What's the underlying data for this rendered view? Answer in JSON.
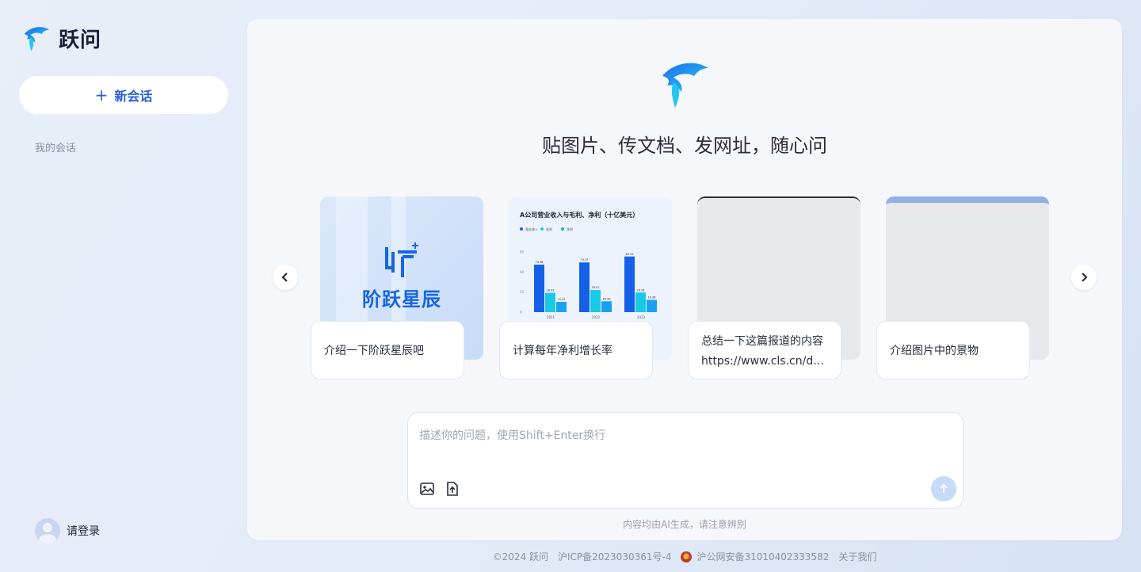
{
  "app": {
    "name": "跃问"
  },
  "sidebar": {
    "new_chat_label": "新会话",
    "section_title": "我的会话",
    "login_label": "请登录"
  },
  "main": {
    "headline": "贴图片、传文档、发网址，随心问",
    "cards": [
      {
        "prompt": "介绍一下阶跃星辰吧",
        "sub": "",
        "brand": "阶跃星辰"
      },
      {
        "prompt": "计算每年净利增长率",
        "sub": ""
      },
      {
        "prompt": "总结一下这篇报道的内容",
        "sub": "https://www.cls.cn/det..."
      },
      {
        "prompt": "介绍图片中的景物",
        "sub": ""
      }
    ],
    "input": {
      "placeholder": "描述你的问题，使用Shift+Enter换行"
    },
    "disclaimer": "内容均由AI生成，请注意辨别"
  },
  "chart_data": {
    "type": "bar",
    "title": "A公司营业收入与毛利、净利（十亿美元）",
    "categories": [
      "2021",
      "2022",
      "2023"
    ],
    "series": [
      {
        "name": "营业收入",
        "values": [
          70.98,
          74.33,
          83.19
        ]
      },
      {
        "name": "毛利",
        "values": [
          28.92,
          33.01,
          29.28
        ]
      },
      {
        "name": "净利",
        "values": [
          15.32,
          16.28,
          18.36
        ]
      }
    ],
    "ylim": [
      0,
      90
    ],
    "yticks": [
      "90",
      "60",
      "30",
      "0"
    ],
    "colors": [
      "#1560e8",
      "#19c9e6",
      "#1aa0f0"
    ]
  },
  "footer": {
    "copyright": "©2024 跃问",
    "icp": "沪ICP备2023030361号-4",
    "police": "沪公网安备31010402333582",
    "about": "关于我们"
  },
  "colors": {
    "accent": "#2a5fd6",
    "brand_blue": "#1565e8"
  }
}
